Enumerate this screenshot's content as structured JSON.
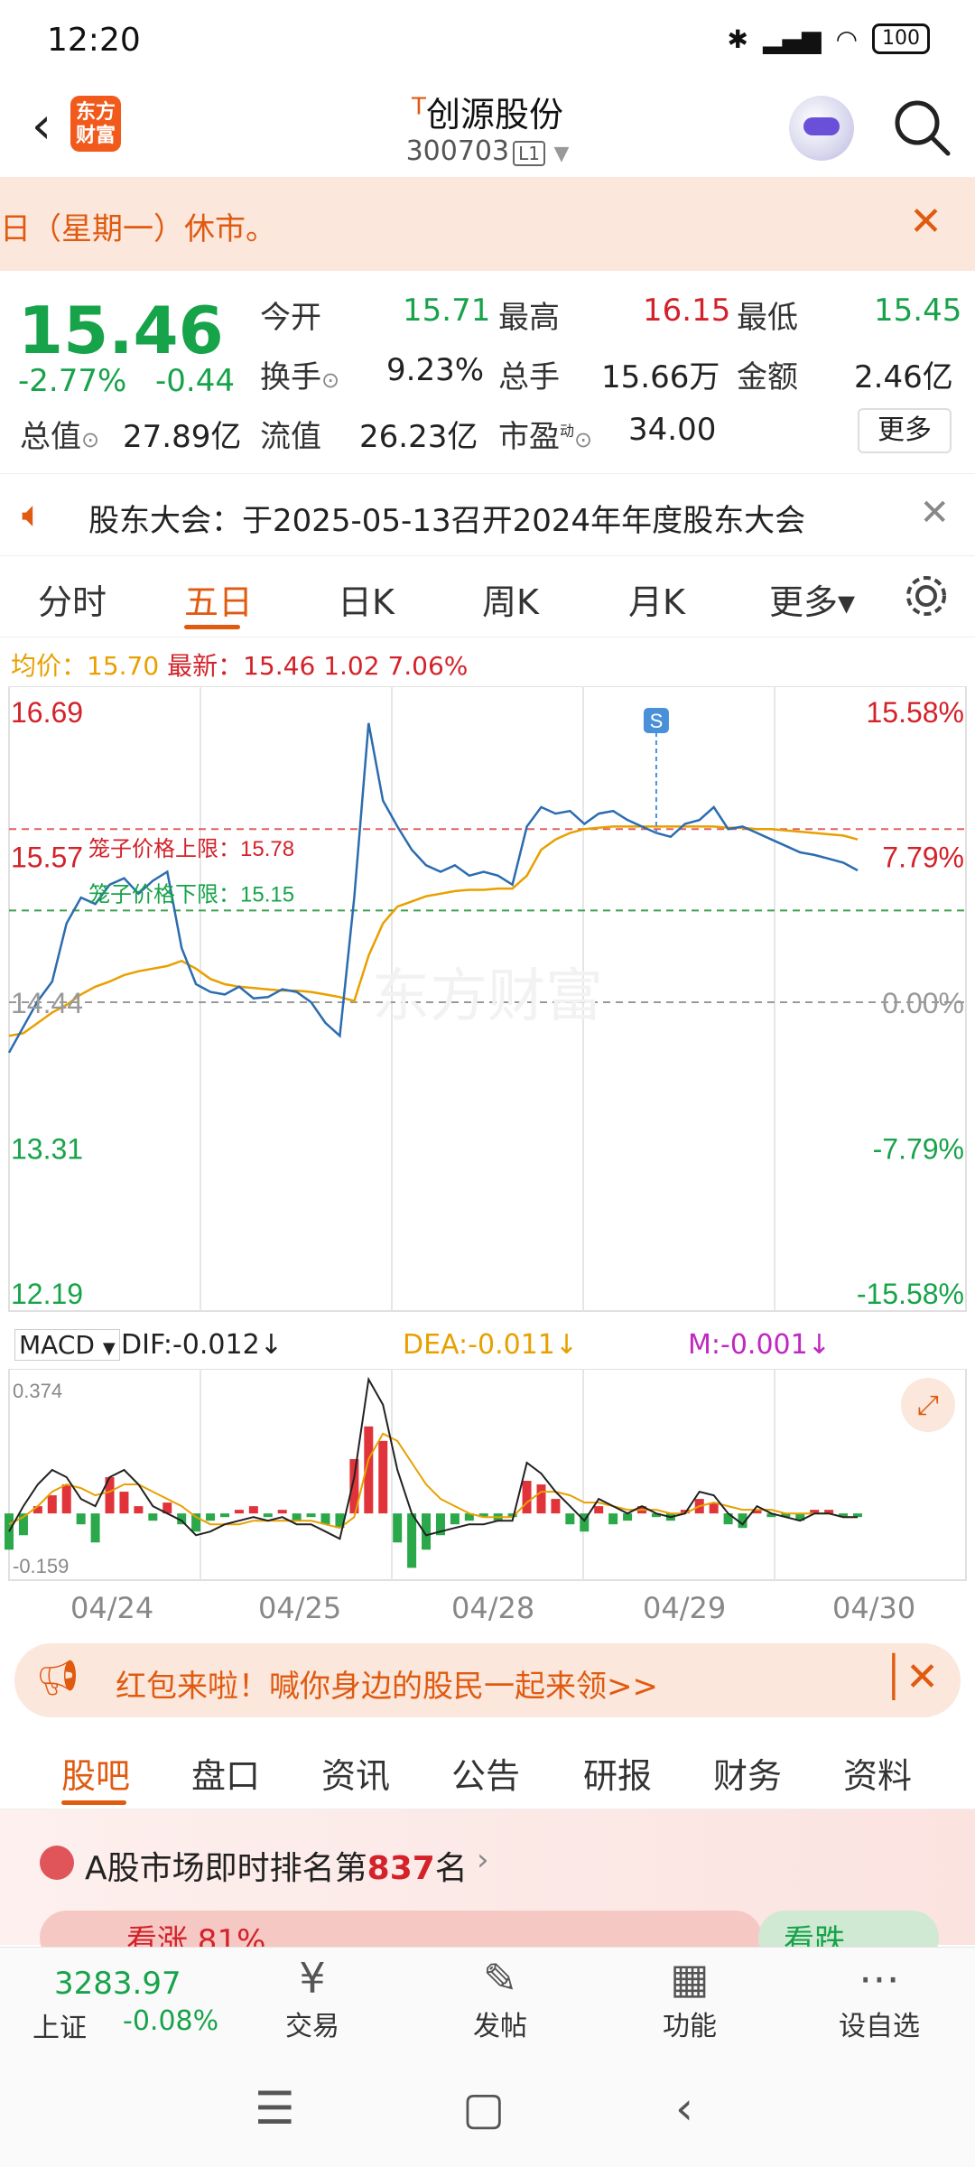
{
  "status": {
    "time": "12:20",
    "battery": "100"
  },
  "header": {
    "logo": "东方\n财富",
    "tmark": "T",
    "stock_name": "创源股份",
    "stock_code": "300703",
    "level": "L1"
  },
  "notice": {
    "text": "日（星期一）休市。"
  },
  "quote": {
    "price": "15.46",
    "change_pct": "-2.77%",
    "change": "-0.44",
    "rows": [
      [
        {
          "label": "今开",
          "value": "15.71",
          "color": "g"
        },
        {
          "label": "最高",
          "value": "16.15",
          "color": "r"
        },
        {
          "label": "最低",
          "value": "15.45",
          "color": "g"
        }
      ],
      [
        {
          "label": "换手",
          "value": "9.23%",
          "color": "k"
        },
        {
          "label": "总手",
          "value": "15.66万",
          "color": "k"
        },
        {
          "label": "金额",
          "value": "2.46亿",
          "color": "k"
        }
      ],
      [
        {
          "label": "总值",
          "value": "27.89亿",
          "color": "k"
        },
        {
          "label": "流值",
          "value": "26.23亿",
          "color": "k"
        },
        {
          "label": "市盈",
          "value": "34.00",
          "color": "k"
        }
      ]
    ],
    "more": "更多",
    "pe_dyn": "动"
  },
  "notice2": {
    "text": "股东大会：于2025-05-13召开2024年年度股东大会"
  },
  "tabs": [
    "分时",
    "五日",
    "日K",
    "周K",
    "月K",
    "更多▾"
  ],
  "info": {
    "avg_label": "均价：",
    "avg": "15.70",
    "latest_label": "最新：",
    "latest": "15.46",
    "chg": "1.02",
    "pct": "7.06%"
  },
  "chart_data": {
    "type": "line",
    "title": "",
    "y_left": [
      "16.69",
      "15.57",
      "14.44",
      "13.31",
      "12.19"
    ],
    "y_right": [
      "15.58%",
      "7.79%",
      "0.00%",
      "-7.79%",
      "-15.58%"
    ],
    "ylim": [
      12.19,
      16.69
    ],
    "base": 14.44,
    "upper_limit_label": "笼子价格上限：15.78",
    "lower_limit_label": "笼子价格下限：15.15",
    "upper_limit": 15.78,
    "lower_limit": 15.15,
    "days": [
      "04/24",
      "04/25",
      "04/28",
      "04/29",
      "04/30"
    ],
    "watermark": "东方财富",
    "s_marker": "S",
    "price_series": {
      "name": "最新",
      "values": [
        14.05,
        14.25,
        14.45,
        14.6,
        15.05,
        15.25,
        15.2,
        15.35,
        15.4,
        15.28,
        15.38,
        15.45,
        14.86,
        14.58,
        14.52,
        14.5,
        14.56,
        14.47,
        14.48,
        14.54,
        14.52,
        14.44,
        14.28,
        14.18,
        15.25,
        16.6,
        16.0,
        15.8,
        15.62,
        15.5,
        15.45,
        15.5,
        15.42,
        15.45,
        15.42,
        15.35,
        15.8,
        15.95,
        15.9,
        15.92,
        15.82,
        15.9,
        15.92,
        15.85,
        15.8,
        15.75,
        15.72,
        15.82,
        15.85,
        15.95,
        15.78,
        15.8,
        15.75,
        15.7,
        15.65,
        15.6,
        15.58,
        15.55,
        15.52,
        15.46
      ]
    },
    "avg_series": {
      "name": "均价",
      "values": [
        14.18,
        14.2,
        14.28,
        14.36,
        14.42,
        14.5,
        14.56,
        14.6,
        14.65,
        14.68,
        14.7,
        14.72,
        14.76,
        14.7,
        14.62,
        14.58,
        14.56,
        14.55,
        14.54,
        14.53,
        14.53,
        14.52,
        14.5,
        14.48,
        14.45,
        14.8,
        15.05,
        15.18,
        15.22,
        15.26,
        15.28,
        15.3,
        15.31,
        15.31,
        15.32,
        15.32,
        15.42,
        15.62,
        15.7,
        15.75,
        15.78,
        15.79,
        15.8,
        15.8,
        15.8,
        15.8,
        15.8,
        15.8,
        15.8,
        15.8,
        15.79,
        15.79,
        15.78,
        15.78,
        15.77,
        15.76,
        15.75,
        15.74,
        15.73,
        15.7
      ]
    }
  },
  "macd": {
    "label": "MACD",
    "dif": "DIF:-0.012↓",
    "dea": "DEA:-0.011↓",
    "m": "M:-0.001↓",
    "max": "0.374",
    "min": "-0.159",
    "ylim": [
      -0.159,
      0.374
    ],
    "bars": [
      -0.1,
      -0.06,
      0.02,
      0.05,
      0.08,
      -0.03,
      -0.08,
      0.1,
      0.06,
      0.02,
      -0.02,
      0.03,
      -0.03,
      -0.05,
      -0.02,
      -0.01,
      0.01,
      0.02,
      -0.01,
      0.01,
      -0.02,
      -0.01,
      -0.03,
      -0.04,
      0.15,
      0.24,
      0.2,
      -0.08,
      -0.15,
      -0.1,
      -0.06,
      -0.03,
      -0.02,
      -0.01,
      -0.02,
      -0.01,
      0.09,
      0.08,
      0.04,
      -0.03,
      -0.05,
      0.02,
      -0.03,
      -0.02,
      0.02,
      -0.01,
      -0.02,
      0.01,
      0.04,
      0.03,
      -0.03,
      -0.04,
      0.01,
      -0.01,
      -0.01,
      -0.02,
      0.01,
      0.01,
      -0.01,
      -0.01
    ],
    "dif_series": [
      -0.05,
      0.02,
      0.08,
      0.12,
      0.1,
      0.04,
      0.02,
      0.1,
      0.12,
      0.08,
      0.02,
      0.0,
      -0.02,
      -0.06,
      -0.05,
      -0.03,
      -0.02,
      -0.01,
      -0.02,
      -0.01,
      -0.03,
      -0.03,
      -0.05,
      -0.07,
      0.1,
      0.37,
      0.3,
      0.12,
      0.0,
      -0.06,
      -0.05,
      -0.04,
      -0.03,
      -0.03,
      -0.02,
      -0.02,
      0.14,
      0.11,
      0.06,
      0.02,
      -0.02,
      0.04,
      0.02,
      0.0,
      0.02,
      0.0,
      -0.01,
      0.0,
      0.06,
      0.05,
      0.0,
      -0.03,
      0.02,
      0.0,
      -0.01,
      -0.02,
      0.0,
      0.0,
      -0.01,
      -0.01
    ],
    "dea_series": [
      -0.03,
      -0.01,
      0.02,
      0.06,
      0.08,
      0.07,
      0.05,
      0.06,
      0.08,
      0.08,
      0.06,
      0.04,
      0.02,
      -0.01,
      -0.03,
      -0.03,
      -0.03,
      -0.02,
      -0.02,
      -0.02,
      -0.02,
      -0.02,
      -0.03,
      -0.04,
      -0.01,
      0.15,
      0.22,
      0.2,
      0.14,
      0.08,
      0.04,
      0.02,
      0.0,
      -0.01,
      -0.01,
      -0.01,
      0.03,
      0.06,
      0.06,
      0.05,
      0.03,
      0.03,
      0.02,
      0.01,
      0.01,
      0.01,
      0.0,
      0.0,
      0.02,
      0.03,
      0.02,
      0.01,
      0.01,
      0.01,
      0.0,
      0.0,
      0.0,
      0.0,
      -0.01,
      -0.01
    ]
  },
  "red_packet": {
    "text": "红包来啦！喊你身边的股民一起来领>>"
  },
  "bottom_tabs": [
    "股吧",
    "盘口",
    "资讯",
    "公告",
    "研报",
    "财务",
    "资料"
  ],
  "rank": {
    "prefix": "A股市场即时排名第",
    "number": "837",
    "suffix": "名",
    "bull": "看涨 81%",
    "bear": "看跌"
  },
  "index": {
    "value": "3283.97",
    "name": "上证",
    "change": "-0.08%"
  },
  "bottom_nav": [
    {
      "icon": "trade-icon",
      "label": "交易"
    },
    {
      "icon": "post-icon",
      "label": "发帖"
    },
    {
      "icon": "apps-icon",
      "label": "功能"
    },
    {
      "icon": "more-icon",
      "label": "设自选"
    }
  ],
  "colors": {
    "accent": "#e05a10",
    "up": "#d3222a",
    "down": "#17a34a",
    "avg": "#e8a000",
    "line": "#2b6cb0"
  }
}
